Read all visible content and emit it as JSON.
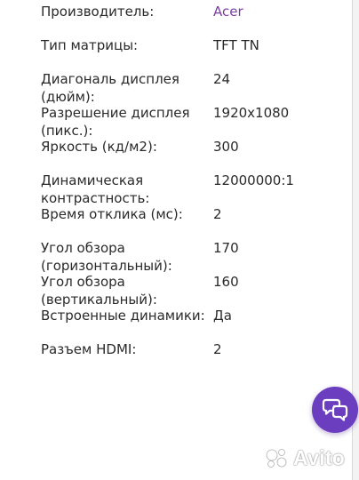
{
  "specs": [
    {
      "label": "Производитель:",
      "value": "Acer"
    },
    {
      "label": "Тип матрицы:",
      "value": "TFT TN"
    },
    {
      "label": "Диагональ дисплея (дюйм):",
      "value": "24"
    },
    {
      "label": "Разрешение дисплея (пикс.):",
      "value": "1920x1080"
    },
    {
      "label": "Яркость (кд/м2):",
      "value": "300"
    },
    {
      "label": "Динамическая контрастность:",
      "value": "12000000:1"
    },
    {
      "label": "Время отклика (мс):",
      "value": "2"
    },
    {
      "label": "Угол обзора (горизонтальный):",
      "value": "170"
    },
    {
      "label": "Угол обзора (вертикальный):",
      "value": "160"
    },
    {
      "label": "Встроенные динамики:",
      "value": "Да"
    },
    {
      "label": "Разъем HDMI:",
      "value": "2"
    }
  ],
  "colors": {
    "text": "#2a2a2a",
    "link": "#7a3ea0",
    "chat_button": "#6b3ec0"
  },
  "chat_button": {
    "icon": "chat-bubbles-icon"
  },
  "watermark": {
    "text": "Avito",
    "icon": "avito-dots-icon"
  }
}
